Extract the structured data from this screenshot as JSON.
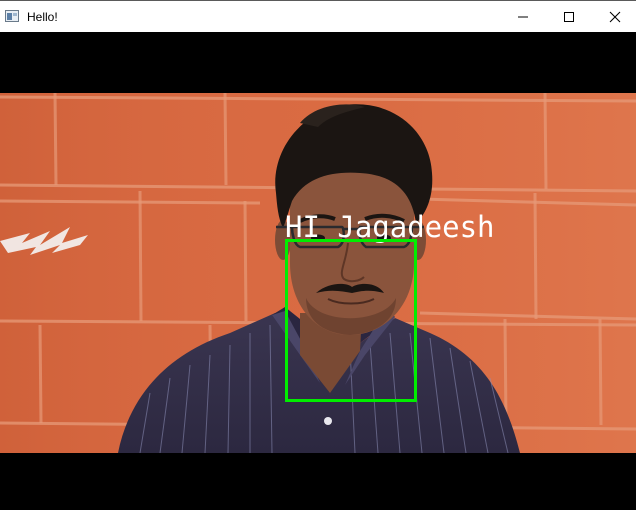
{
  "window": {
    "title": "Hello!",
    "app_icon": "app-window-icon",
    "controls": {
      "minimize_icon": "minimize-icon",
      "maximize_icon": "maximize-icon",
      "close_icon": "close-icon"
    }
  },
  "camera": {
    "overlay_text": "HI Jagadeesh",
    "overlay_text_color": "#ffffff",
    "face_box_color": "#00ee00"
  }
}
